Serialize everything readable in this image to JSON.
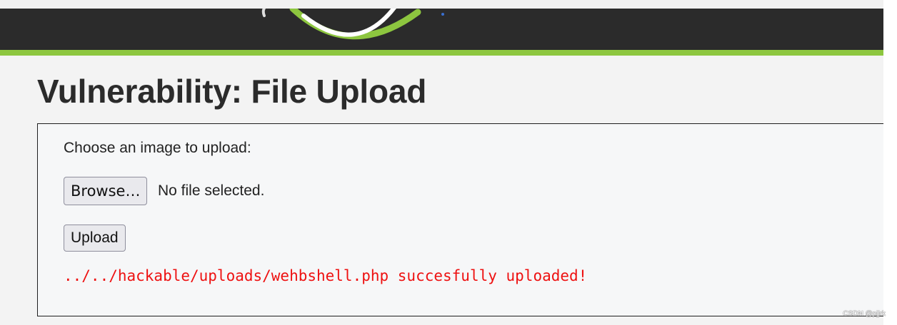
{
  "page": {
    "title": "Vulnerability: File Upload"
  },
  "upload_form": {
    "prompt": "Choose an image to upload:",
    "browse_label": "Browse…",
    "file_status": "No file selected.",
    "upload_label": "Upload",
    "result_message": "../../hackable/uploads/wehbshell.php succesfully uploaded!"
  },
  "watermark": {
    "text": "CSDN @pjjrk"
  },
  "colors": {
    "header_bg": "#2b2b2b",
    "accent": "#8dc63f",
    "page_bg": "#f3f3f3",
    "title": "#2b2b2b",
    "result_text": "#ee1111"
  },
  "icons": {
    "logo": "dvwa-logo-icon"
  }
}
